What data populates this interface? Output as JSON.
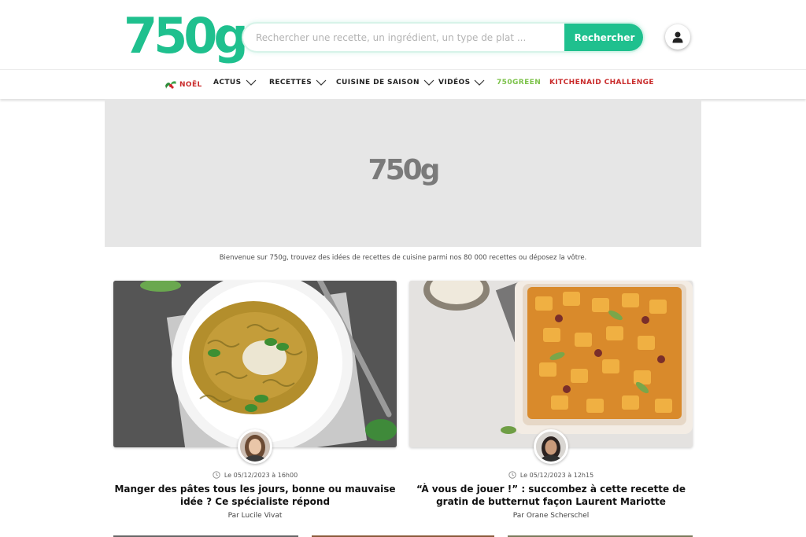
{
  "header": {
    "logo": "750g",
    "search_placeholder": "Rechercher une recette, un ingrédient, un type de plat ...",
    "search_button": "Rechercher",
    "account_icon": "user-icon"
  },
  "nav": {
    "items": [
      {
        "label": "NOËL",
        "icon": "holly-icon"
      },
      {
        "label": "ACTUS"
      },
      {
        "label": "RECETTES"
      },
      {
        "label": "CUISINE DE SAISON"
      },
      {
        "label": "VIDÉOS"
      },
      {
        "label": "750GREEN"
      },
      {
        "label": "KITCHENAID CHALLENGE"
      }
    ]
  },
  "banner": {
    "logo": "750g"
  },
  "welcome": "Bienvenue sur 750g, trouvez des idées de recettes de cuisine parmi nos 80 000 recettes ou déposez la vôtre.",
  "articles": [
    {
      "date": "Le 05/12/2023 à 16h00",
      "title": "Manger des pâtes tous les jours, bonne ou mauvaise idée ? Ce spécialiste répond",
      "author": "Par Lucile Vivat"
    },
    {
      "date": "Le 05/12/2023 à 12h15",
      "title": "“À vous de jouer !” : succombez à cette recette de gratin de butternut façon Laurent Mariotte",
      "author": "Par Orane Scherschel"
    }
  ],
  "colors": {
    "brand": "#1fc08e",
    "noel": "#c92b2b",
    "green": "#7cc24a",
    "kitchenaid": "#c92b2b"
  }
}
